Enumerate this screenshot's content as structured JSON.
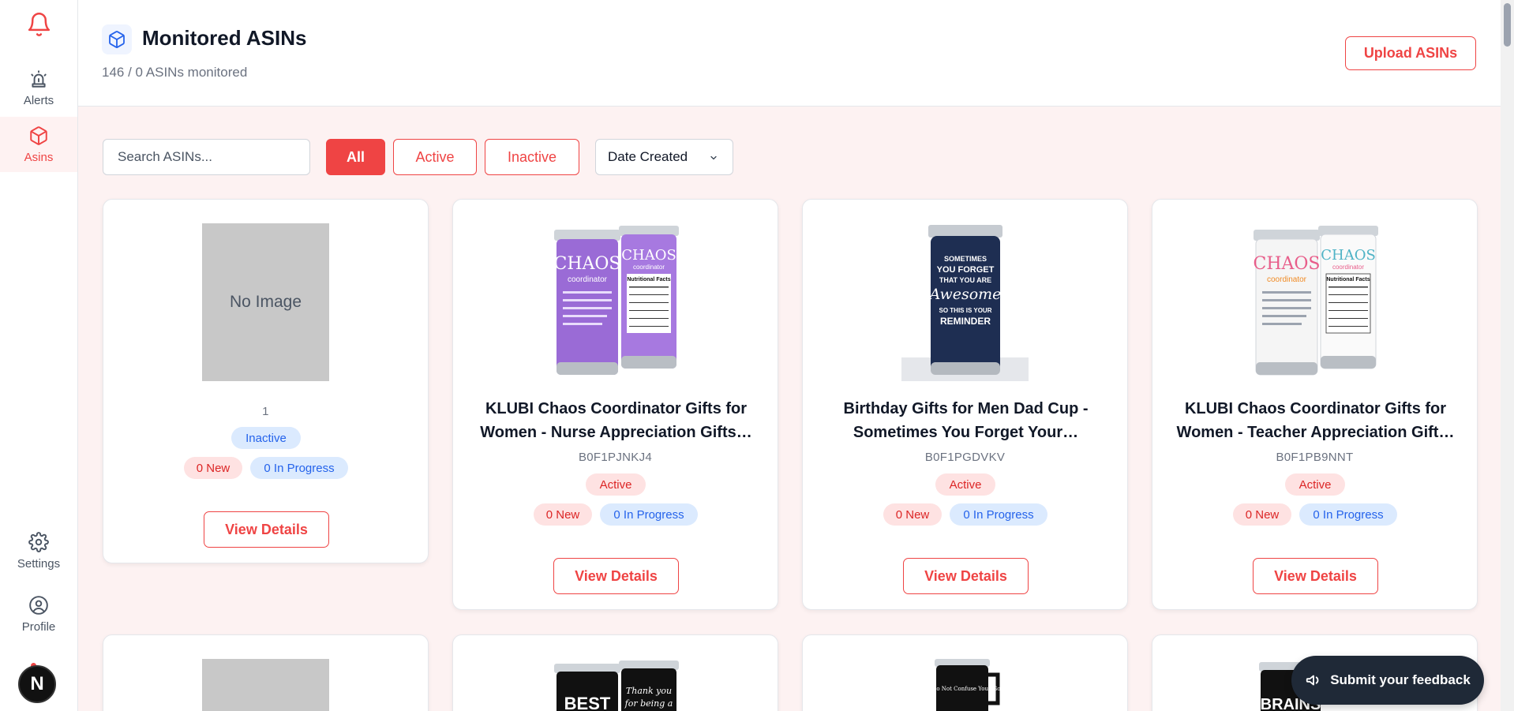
{
  "sidebar": {
    "items": [
      {
        "label": "Alerts"
      },
      {
        "label": "Asins"
      },
      {
        "label": "Settings"
      },
      {
        "label": "Profile"
      }
    ],
    "avatar_letter": "N"
  },
  "header": {
    "title": "Monitored ASINs",
    "subtitle": "146 / 0 ASINs monitored",
    "upload_label": "Upload ASINs"
  },
  "toolbar": {
    "search_placeholder": "Search ASINs...",
    "filters": [
      "All",
      "Active",
      "Inactive"
    ],
    "selected_filter": "All",
    "sort_value": "Date Created"
  },
  "cards": [
    {
      "image": "none",
      "no_image_label": "No Image",
      "title": "",
      "asin": "1",
      "status": "Inactive",
      "new_label": "0 New",
      "progress_label": "0 In Progress",
      "button_label": "View Details"
    },
    {
      "image": "purple-tumbler-pair",
      "title": "KLUBI Chaos Coordinator Gifts for Women - Nurse Appreciation Gifts…",
      "asin": "B0F1PJNKJ4",
      "status": "Active",
      "new_label": "0 New",
      "progress_label": "0 In Progress",
      "button_label": "View Details"
    },
    {
      "image": "navy-tumbler",
      "title": "Birthday Gifts for Men Dad Cup - Sometimes You Forget Your…",
      "asin": "B0F1PGDVKV",
      "status": "Active",
      "new_label": "0 New",
      "progress_label": "0 In Progress",
      "button_label": "View Details"
    },
    {
      "image": "white-tumbler-pair",
      "title": "KLUBI Chaos Coordinator Gifts for Women - Teacher Appreciation Gift…",
      "asin": "B0F1PB9NNT",
      "status": "Active",
      "new_label": "0 New",
      "progress_label": "0 In Progress",
      "button_label": "View Details"
    }
  ],
  "tumbler_text": {
    "chaos": "CHAOS",
    "coordinator": "coordinator",
    "nutrition": "Nutritional Facts",
    "navy_lines": [
      "SOMETIMES",
      "YOU FORGET",
      "THAT YOU ARE",
      "Awesome",
      "SO THIS IS YOUR",
      "REMINDER"
    ],
    "row2_best": "BEST",
    "row2_thank": "Thank you",
    "row2_being": "for being a",
    "row2_mug": "Please Do Not Confuse Your Google",
    "row2_brains": "BRAINS"
  },
  "feedback_label": "Submit your feedback",
  "colors": {
    "accent": "#ef4444",
    "page_bg": "#fdf2f2",
    "blue_badge": "#dbeafe"
  }
}
